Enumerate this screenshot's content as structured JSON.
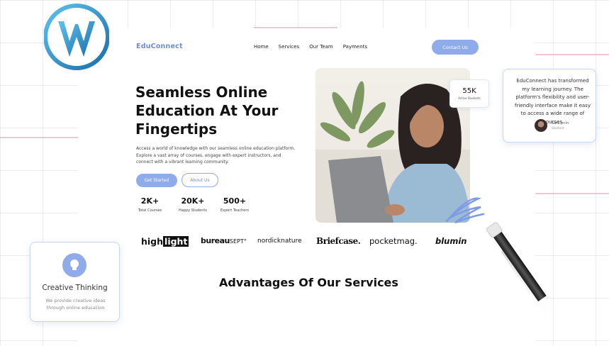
{
  "brand": {
    "name": "EduConnect",
    "accent": "#8fabea"
  },
  "nav": {
    "items": [
      "Home",
      "Services",
      "Our Team",
      "Payments"
    ],
    "cta": "Contact Us"
  },
  "hero": {
    "title": "Seamless Online Education At Your Fingertips",
    "description": "Access a world of knowledge with our seamless online education platform. Explore a vast array of courses, engage with expert instructors, and connect with a vibrant learning community.",
    "primary_button": "Get Started",
    "secondary_button": "About Us",
    "stats": [
      {
        "value": "2K+",
        "label": "Total Courses"
      },
      {
        "value": "20K+",
        "label": "Happy Students"
      },
      {
        "value": "500+",
        "label": "Expert Teachers"
      }
    ],
    "students_badge": {
      "value": "55K",
      "label": "Active Students"
    }
  },
  "testimonial": {
    "quote": "EduConnect has transformed my learning journey. The platform's flexibility and user-friendly interface make it easy to access a wide range of courses",
    "name": "Sara Jerin",
    "role": "Student"
  },
  "brands": {
    "highlight_a": "high",
    "highlight_b": "light",
    "bureau_a": "bureau",
    "bureau_b": "SEPT°",
    "nordic": "nordicknature",
    "briefcase": "Briefcase.",
    "pocketmag": "pocketmag.",
    "blumin": "blumin"
  },
  "advantages": {
    "title": "Advantages Of Our Services"
  },
  "creative_card": {
    "title": "Creative Thinking",
    "description": "We provide creative ideas through online education"
  },
  "icons": {
    "wordpress": "wordpress-logo-icon",
    "bulb": "lightbulb-icon",
    "pen": "stylus-pen-icon"
  }
}
